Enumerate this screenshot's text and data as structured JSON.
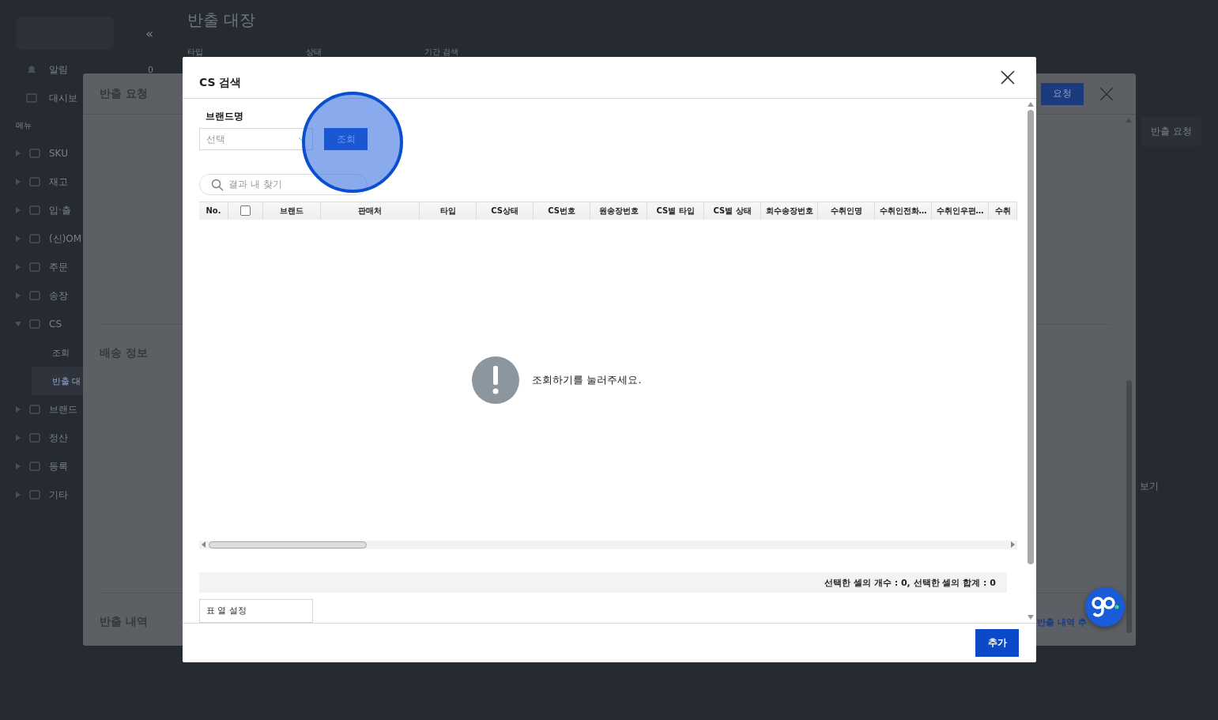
{
  "app": {
    "collapse": "«",
    "page_title": "반출 대장",
    "filters": [
      "타입",
      "상태",
      "기간 검색"
    ],
    "sidebar": {
      "top_items": [
        {
          "label": "알림",
          "badge": "0"
        },
        {
          "label": "대시보"
        }
      ],
      "section_label": "메뉴",
      "items": [
        {
          "label": "SKU",
          "expanded": false
        },
        {
          "label": "재고",
          "expanded": false
        },
        {
          "label": "입·출",
          "expanded": false
        },
        {
          "label": "(신)OM",
          "expanded": false
        },
        {
          "label": "주문",
          "expanded": false
        },
        {
          "label": "송장",
          "expanded": false
        },
        {
          "label": "CS",
          "expanded": true,
          "children": [
            {
              "label": "조회",
              "selected": false
            },
            {
              "label": "반출 대",
              "selected": true
            }
          ]
        },
        {
          "label": "브랜드",
          "expanded": false
        },
        {
          "label": "정산",
          "expanded": false
        },
        {
          "label": "등록",
          "expanded": false
        },
        {
          "label": "기타",
          "expanded": false
        }
      ]
    },
    "right_button": "반출 요청",
    "right_link": "보기"
  },
  "request_modal": {
    "title": "반출 요청",
    "submit": "요청",
    "sections": [
      "배송 정보",
      "반출 내역"
    ],
    "add_link": "반출 내역 추"
  },
  "cs_modal": {
    "title": "CS 검색",
    "brand_label": "브랜드명",
    "brand_select": {
      "placeholder": "선택"
    },
    "search_button": "조회",
    "result_search": {
      "placeholder": "결과 내 찾기"
    },
    "columns": [
      "No.",
      "",
      "브랜드",
      "판매처",
      "타입",
      "CS상태",
      "CS번호",
      "원송장번호",
      "CS별 타입",
      "CS별 상태",
      "회수송장번호",
      "수취인명",
      "수취인전화…",
      "수취인우편…",
      "수취"
    ],
    "select_all": {
      "checked": false
    },
    "empty_message": "조회하기를 눌러주세요.",
    "summary": "선택한 셀의 개수 : 0, 선택한 셀의 합계 : 0",
    "column_settings": "표 열 설정",
    "add_button": "추가"
  }
}
